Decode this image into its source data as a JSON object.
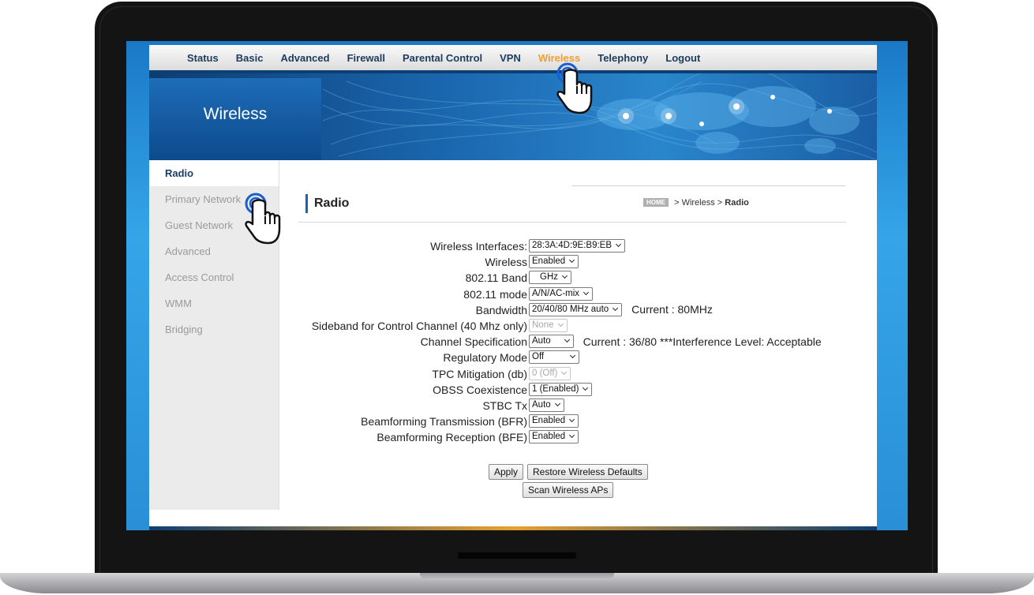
{
  "nav": {
    "items": [
      "Status",
      "Basic",
      "Advanced",
      "Firewall",
      "Parental Control",
      "VPN",
      "Wireless",
      "Telephony",
      "Logout"
    ],
    "active": "Wireless"
  },
  "banner": {
    "title": "Wireless"
  },
  "sidebar": {
    "items": [
      "Radio",
      "Primary Network",
      "Guest Network",
      "Advanced",
      "Access Control",
      "WMM",
      "Bridging"
    ],
    "active": "Radio"
  },
  "page": {
    "title": "Radio",
    "breadcrumb": {
      "home": "HOME",
      "sep": ">",
      "section": "Wireless",
      "current": "Radio"
    }
  },
  "form": {
    "rows": [
      {
        "label": "Wireless Interfaces:",
        "value": "28:3A:4D:9E:B9:EB"
      },
      {
        "label": "Wireless",
        "value": "Enabled"
      },
      {
        "label": "802.11 Band",
        "value": "GHz"
      },
      {
        "label": "802.11 mode",
        "value": "A/N/AC-mix"
      },
      {
        "label": "Bandwidth",
        "value": "20/40/80 MHz auto",
        "extra": "Current :  80MHz"
      },
      {
        "label": "Sideband for Control Channel (40 Mhz only)",
        "value": "None",
        "disabled": true
      },
      {
        "label": "Channel Specification",
        "value": "Auto",
        "extra": "Current :  36/80 ***Interference Level: Acceptable"
      },
      {
        "label": "Regulatory Mode",
        "value": "Off"
      },
      {
        "label": "TPC Mitigation (db)",
        "value": "0 (Off)",
        "disabled": true
      },
      {
        "label": "OBSS Coexistence",
        "value": "1 (Enabled)"
      },
      {
        "label": "STBC Tx",
        "value": "Auto"
      },
      {
        "label": "Beamforming Transmission (BFR)",
        "value": "Enabled"
      },
      {
        "label": "Beamforming Reception (BFE)",
        "value": "Enabled"
      }
    ]
  },
  "buttons": {
    "apply": "Apply",
    "restore": "Restore Wireless Defaults",
    "scan": "Scan Wireless APs"
  },
  "colors": {
    "nav_active": "#f0a030",
    "nav_text": "#1d3b5c",
    "banner_dark": "#0c3d72",
    "screen_blue": "#2a8fd6",
    "sidebar_bg": "#ebebeb"
  },
  "icons": [
    "tap-hand-cursor-icon",
    "select-arrow-icon",
    "world-map-graphic"
  ]
}
